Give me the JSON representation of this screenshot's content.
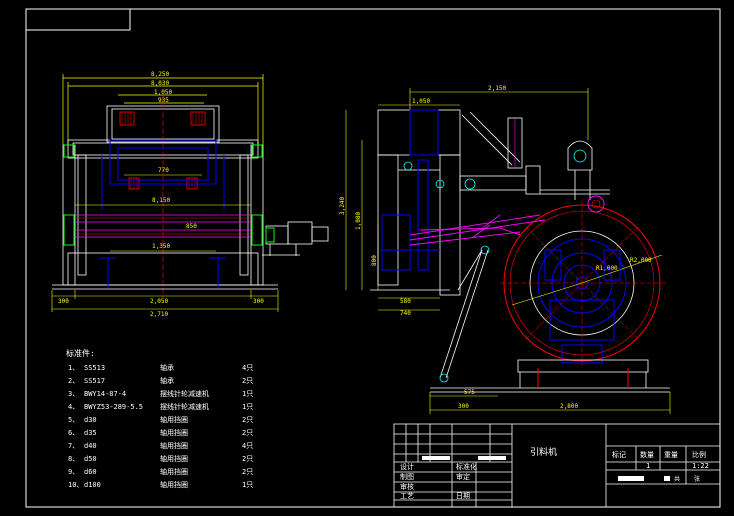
{
  "dimensions": {
    "top_8250": "8,250",
    "top_8030": "8,030",
    "top_1050": "1,050",
    "top_935": "935",
    "mid_770": "770",
    "mid_8150": "8,150",
    "mid_850": "850",
    "mid_1350": "1,350",
    "bot_300_l": "300",
    "bot_2050": "2,050",
    "bot_300_r": "300",
    "bot_2710": "2,710",
    "side_1050": "1,050",
    "side_2150": "2,150",
    "side_3240": "3,240",
    "side_1080": "1,080",
    "side_800": "800",
    "side_580": "580",
    "side_740": "740",
    "side_575": "575",
    "side_300": "300",
    "side_2800": "2,800",
    "r_1000": "R1,000",
    "r_2000": "R2,000"
  },
  "parts": {
    "title": "标准件:",
    "items": [
      {
        "no": "1、",
        "code": "SS513",
        "name": "轴承",
        "qty": "4只"
      },
      {
        "no": "2、",
        "code": "SS517",
        "name": "轴承",
        "qty": "2只"
      },
      {
        "no": "3、",
        "code": "BWY14-87-4",
        "name": "摆线针轮减速机",
        "qty": "1只"
      },
      {
        "no": "4、",
        "code": "BWYZ53-289-5.5",
        "name": "摆线针轮减速机",
        "qty": "1只"
      },
      {
        "no": "5、",
        "code": "d30",
        "name": "轴用挡圈",
        "qty": "2只"
      },
      {
        "no": "6、",
        "code": "d35",
        "name": "轴用挡圈",
        "qty": "2只"
      },
      {
        "no": "7、",
        "code": "d40",
        "name": "轴用挡圈",
        "qty": "4只"
      },
      {
        "no": "8、",
        "code": "d50",
        "name": "轴用挡圈",
        "qty": "2只"
      },
      {
        "no": "9、",
        "code": "d60",
        "name": "轴用挡圈",
        "qty": "2只"
      },
      {
        "no": "10、",
        "code": "d100",
        "name": "轴用挡圈",
        "qty": "1只"
      }
    ]
  },
  "title_block": {
    "drawing_name": "引料机",
    "rows": [
      "设计",
      "制图",
      "审核",
      "工艺"
    ],
    "col2": [
      "标准化",
      "审定",
      "日期"
    ],
    "header": [
      "标记",
      "数量",
      "重量",
      "比例"
    ],
    "qty": "1",
    "scale": "1:22",
    "sheet_a": "共",
    "sheet_b": "张"
  },
  "colors": {
    "frame": "#ffffff",
    "dim": "#ffff00",
    "part": "#0000ff",
    "axis": "#ff0000",
    "mech": "#ff00ff",
    "green": "#00ff00",
    "cyan": "#00ffff"
  }
}
